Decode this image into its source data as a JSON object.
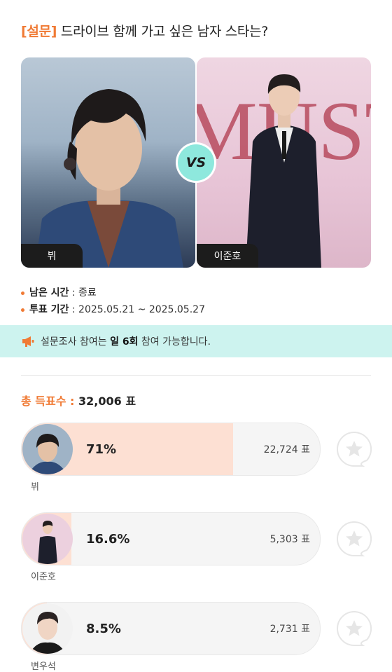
{
  "header": {
    "tag": "[설문]",
    "question": "드라이브 함께 가고 싶은 남자 스타는?"
  },
  "matchup": {
    "left_name": "뷔",
    "right_name": "이준호",
    "vs_label": "VS",
    "right_backdrop_text": "MUST"
  },
  "info": {
    "remaining_label": "남은 시간",
    "remaining_value": "종료",
    "period_label": "투표 기간",
    "period_value": "2025.05.21 ~ 2025.05.27",
    "separator": " : "
  },
  "banner": {
    "prefix": "설문조사 참여는 ",
    "emphasis": "일 6회",
    "suffix": " 참여 가능합니다."
  },
  "total": {
    "label": "총 득표수",
    "separator": " : ",
    "value": "32,006 표"
  },
  "candidates": [
    {
      "name": "뷔",
      "percent_label": "71%",
      "percent": 71,
      "votes": "22,724 표"
    },
    {
      "name": "이준호",
      "percent_label": "16.6%",
      "percent": 16.6,
      "votes": "5,303 표"
    },
    {
      "name": "변우석",
      "percent_label": "8.5%",
      "percent": 8.5,
      "votes": "2,731 표"
    }
  ],
  "icons": {
    "banner": "megaphone-icon",
    "favorite": "star-bubble-icon"
  },
  "colors": {
    "accent": "#f07a34",
    "banner_bg": "#cdf3ef",
    "vs_badge": "#8ee8dd",
    "bar_fill": "#fde0d3",
    "bar_bg": "#f5f5f5"
  }
}
